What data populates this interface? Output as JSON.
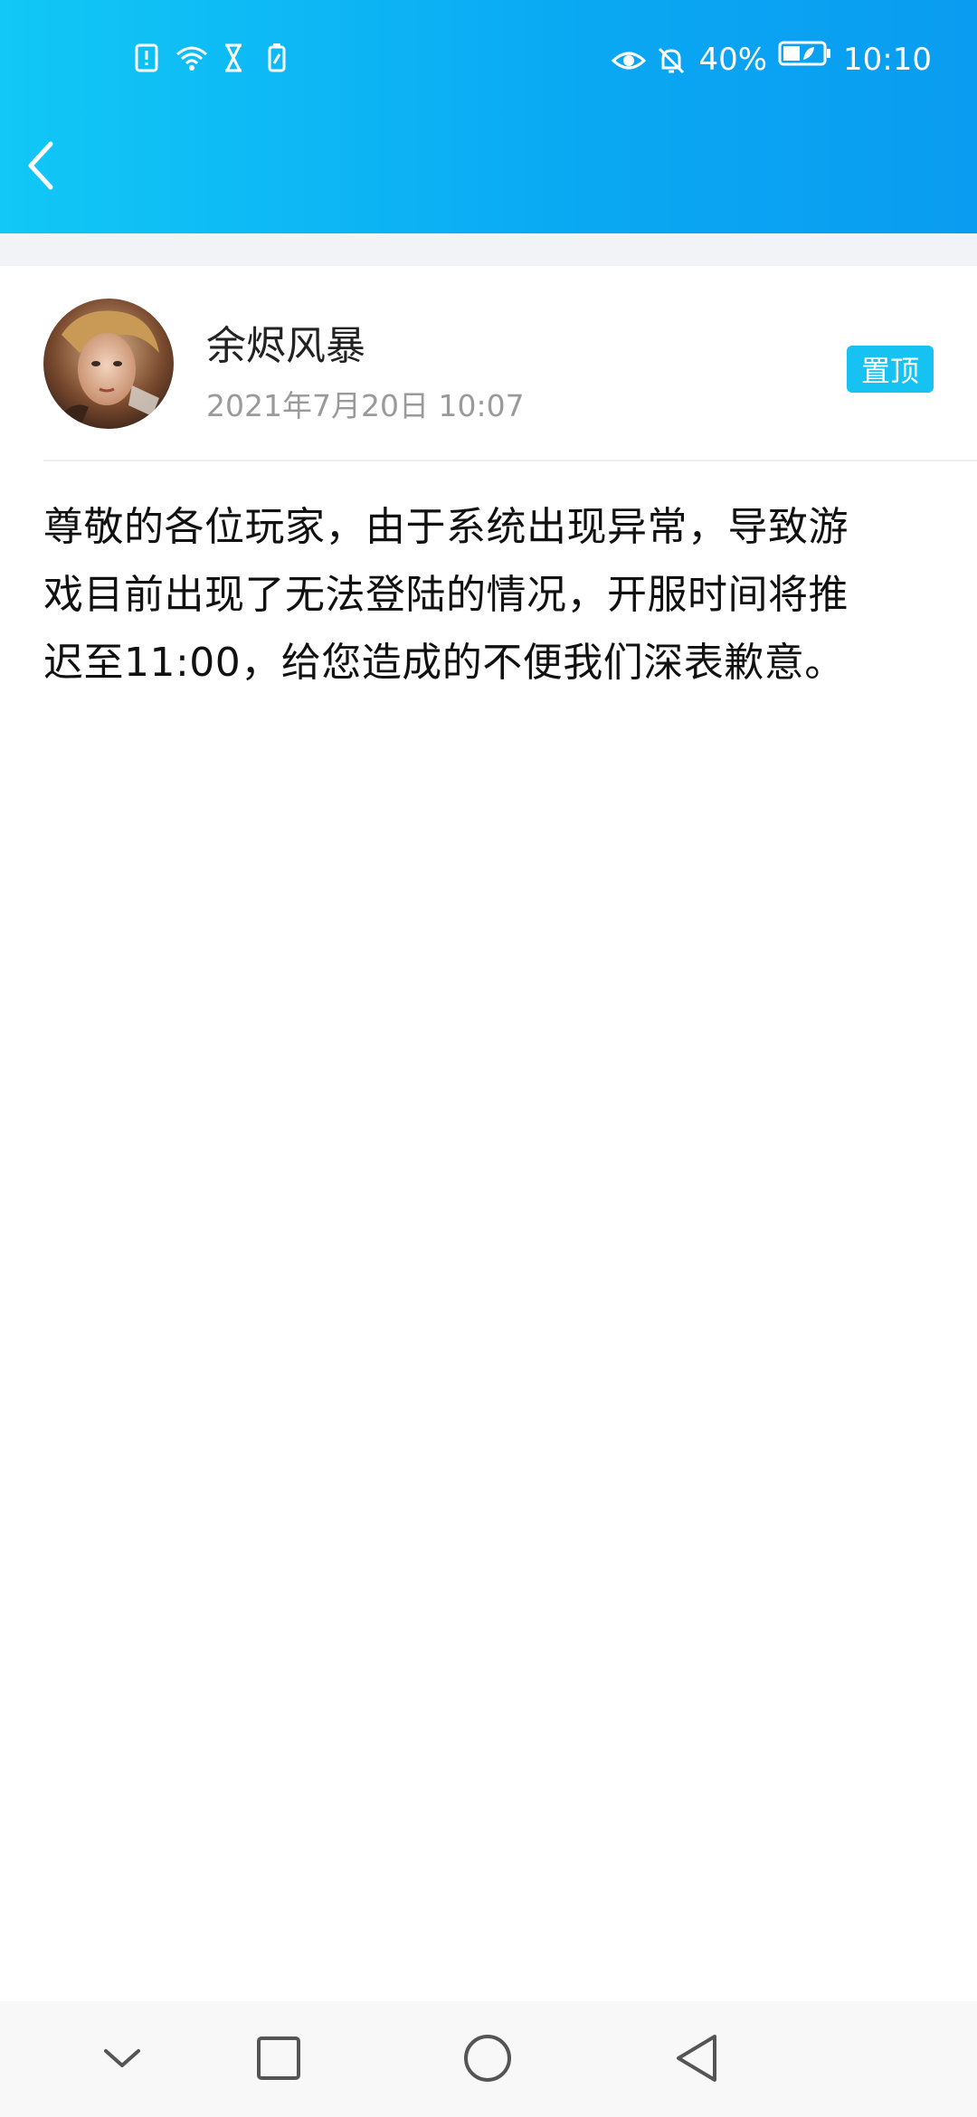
{
  "status_bar": {
    "battery_percent": "40%",
    "time": "10:10",
    "left_icons": [
      "sim-alert-icon",
      "wifi-icon",
      "hourglass-icon",
      "battery-saver-icon"
    ],
    "right_icons": [
      "eye-icon",
      "bell-off-icon",
      "battery-icon"
    ]
  },
  "header": {
    "back_icon": "chevron-left-icon",
    "gradient_start": "#11c8f6",
    "gradient_end": "#0a9cf0"
  },
  "post": {
    "author": "余烬风暴",
    "timestamp": "2021年7月20日 10:07",
    "pin_label": "置顶",
    "lines": [
      "尊敬的各位玩家，由于系统出现异常，导致游",
      "戏目前出现了无法登陆的情况，开服时间将推",
      "迟至11:00，给您造成的不便我们深表歉意。"
    ]
  },
  "colors": {
    "accent": "#16c2f2",
    "timestamp": "#9a9a9a",
    "band": "#f1f3f6"
  },
  "nav_bar": {
    "icons": [
      "collapse-icon",
      "recents-icon",
      "home-icon",
      "back-icon"
    ]
  }
}
